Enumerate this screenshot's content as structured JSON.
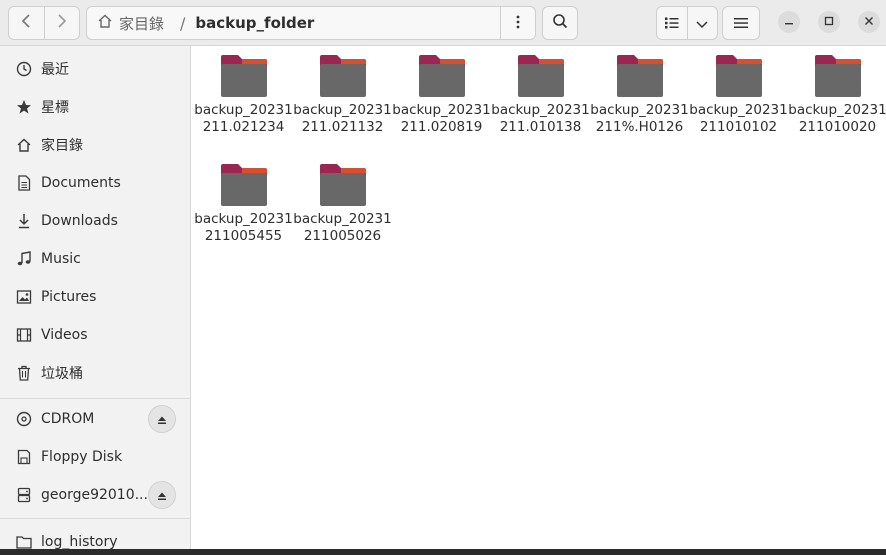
{
  "header": {
    "back_icon": "chevron-left-icon",
    "forward_icon": "chevron-right-icon",
    "home_label": "家目錄",
    "separator": "/",
    "current_folder": "backup_folder",
    "path_menu_icon": "vertical-dots-icon",
    "search_icon": "search-icon",
    "view_icon": "list-view-icon",
    "view_options_icon": "chevron-down-icon",
    "main_menu_icon": "hamburger-icon",
    "window_minimize_icon": "minimize-icon",
    "window_maximize_icon": "maximize-icon",
    "window_close_icon": "close-icon"
  },
  "sidebar": {
    "items": [
      {
        "label": "最近",
        "icon": "clock-icon"
      },
      {
        "label": "星標",
        "icon": "star-icon"
      },
      {
        "label": "家目錄",
        "icon": "home-icon"
      },
      {
        "label": "Documents",
        "icon": "document-icon"
      },
      {
        "label": "Downloads",
        "icon": "download-icon"
      },
      {
        "label": "Music",
        "icon": "music-icon"
      },
      {
        "label": "Pictures",
        "icon": "picture-icon"
      },
      {
        "label": "Videos",
        "icon": "video-icon"
      },
      {
        "label": "垃圾桶",
        "icon": "trash-icon"
      }
    ],
    "devices": [
      {
        "label": "CDROM",
        "icon": "disc-icon",
        "ejectable": true
      },
      {
        "label": "Floppy Disk",
        "icon": "floppy-icon",
        "ejectable": false
      },
      {
        "label": "george92010...",
        "icon": "network-drive-icon",
        "ejectable": true
      },
      {
        "label": "log_history",
        "icon": "folder-icon",
        "ejectable": false
      }
    ]
  },
  "files": [
    {
      "name": "backup_20231211.021234"
    },
    {
      "name": "backup_20231211.021132"
    },
    {
      "name": "backup_20231211.020819"
    },
    {
      "name": "backup_20231211.010138"
    },
    {
      "name": "backup_20231211%.H0126"
    },
    {
      "name": "backup_20231211010102"
    },
    {
      "name": "backup_20231211010020"
    },
    {
      "name": "backup_20231211005455"
    },
    {
      "name": "backup_20231211005026"
    }
  ],
  "colors": {
    "folder_tab": "#9b2652",
    "folder_tab_accent": "#e0572a",
    "folder_body": "#686868"
  }
}
